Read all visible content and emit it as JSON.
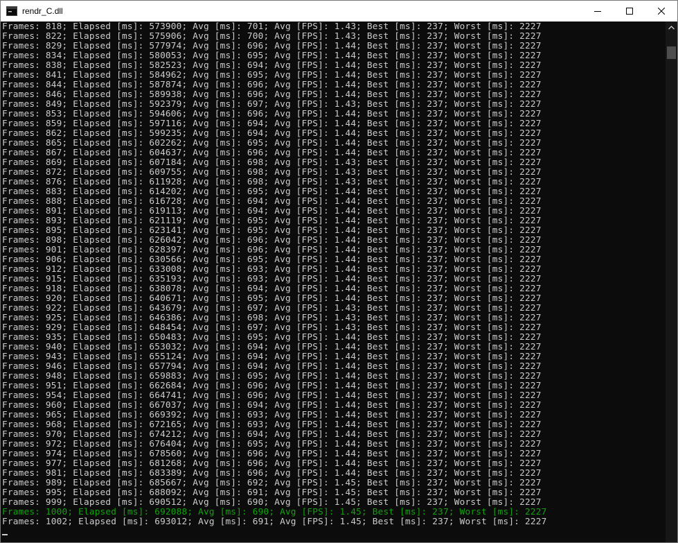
{
  "window": {
    "title": "rendr_C.dll"
  },
  "log": {
    "lines": [
      {
        "text": "Frames: 818; Elapsed [ms]: 573900; Avg [ms]: 701; Avg [FPS]: 1.43; Best [ms]: 237; Worst [ms]: 2227",
        "highlight": false
      },
      {
        "text": "Frames: 822; Elapsed [ms]: 575906; Avg [ms]: 700; Avg [FPS]: 1.43; Best [ms]: 237; Worst [ms]: 2227",
        "highlight": false
      },
      {
        "text": "Frames: 829; Elapsed [ms]: 577974; Avg [ms]: 696; Avg [FPS]: 1.44; Best [ms]: 237; Worst [ms]: 2227",
        "highlight": false
      },
      {
        "text": "Frames: 834; Elapsed [ms]: 580053; Avg [ms]: 695; Avg [FPS]: 1.44; Best [ms]: 237; Worst [ms]: 2227",
        "highlight": false
      },
      {
        "text": "Frames: 838; Elapsed [ms]: 582523; Avg [ms]: 694; Avg [FPS]: 1.44; Best [ms]: 237; Worst [ms]: 2227",
        "highlight": false
      },
      {
        "text": "Frames: 841; Elapsed [ms]: 584962; Avg [ms]: 695; Avg [FPS]: 1.44; Best [ms]: 237; Worst [ms]: 2227",
        "highlight": false
      },
      {
        "text": "Frames: 844; Elapsed [ms]: 587874; Avg [ms]: 696; Avg [FPS]: 1.44; Best [ms]: 237; Worst [ms]: 2227",
        "highlight": false
      },
      {
        "text": "Frames: 846; Elapsed [ms]: 589938; Avg [ms]: 696; Avg [FPS]: 1.44; Best [ms]: 237; Worst [ms]: 2227",
        "highlight": false
      },
      {
        "text": "Frames: 849; Elapsed [ms]: 592379; Avg [ms]: 697; Avg [FPS]: 1.43; Best [ms]: 237; Worst [ms]: 2227",
        "highlight": false
      },
      {
        "text": "Frames: 853; Elapsed [ms]: 594606; Avg [ms]: 696; Avg [FPS]: 1.44; Best [ms]: 237; Worst [ms]: 2227",
        "highlight": false
      },
      {
        "text": "Frames: 859; Elapsed [ms]: 597116; Avg [ms]: 694; Avg [FPS]: 1.44; Best [ms]: 237; Worst [ms]: 2227",
        "highlight": false
      },
      {
        "text": "Frames: 862; Elapsed [ms]: 599235; Avg [ms]: 694; Avg [FPS]: 1.44; Best [ms]: 237; Worst [ms]: 2227",
        "highlight": false
      },
      {
        "text": "Frames: 865; Elapsed [ms]: 602262; Avg [ms]: 695; Avg [FPS]: 1.44; Best [ms]: 237; Worst [ms]: 2227",
        "highlight": false
      },
      {
        "text": "Frames: 867; Elapsed [ms]: 604637; Avg [ms]: 696; Avg [FPS]: 1.44; Best [ms]: 237; Worst [ms]: 2227",
        "highlight": false
      },
      {
        "text": "Frames: 869; Elapsed [ms]: 607184; Avg [ms]: 698; Avg [FPS]: 1.43; Best [ms]: 237; Worst [ms]: 2227",
        "highlight": false
      },
      {
        "text": "Frames: 872; Elapsed [ms]: 609755; Avg [ms]: 698; Avg [FPS]: 1.43; Best [ms]: 237; Worst [ms]: 2227",
        "highlight": false
      },
      {
        "text": "Frames: 876; Elapsed [ms]: 611928; Avg [ms]: 698; Avg [FPS]: 1.43; Best [ms]: 237; Worst [ms]: 2227",
        "highlight": false
      },
      {
        "text": "Frames: 883; Elapsed [ms]: 614202; Avg [ms]: 695; Avg [FPS]: 1.44; Best [ms]: 237; Worst [ms]: 2227",
        "highlight": false
      },
      {
        "text": "Frames: 888; Elapsed [ms]: 616728; Avg [ms]: 694; Avg [FPS]: 1.44; Best [ms]: 237; Worst [ms]: 2227",
        "highlight": false
      },
      {
        "text": "Frames: 891; Elapsed [ms]: 619113; Avg [ms]: 694; Avg [FPS]: 1.44; Best [ms]: 237; Worst [ms]: 2227",
        "highlight": false
      },
      {
        "text": "Frames: 893; Elapsed [ms]: 621119; Avg [ms]: 695; Avg [FPS]: 1.44; Best [ms]: 237; Worst [ms]: 2227",
        "highlight": false
      },
      {
        "text": "Frames: 895; Elapsed [ms]: 623141; Avg [ms]: 695; Avg [FPS]: 1.44; Best [ms]: 237; Worst [ms]: 2227",
        "highlight": false
      },
      {
        "text": "Frames: 898; Elapsed [ms]: 626042; Avg [ms]: 696; Avg [FPS]: 1.44; Best [ms]: 237; Worst [ms]: 2227",
        "highlight": false
      },
      {
        "text": "Frames: 901; Elapsed [ms]: 628397; Avg [ms]: 696; Avg [FPS]: 1.44; Best [ms]: 237; Worst [ms]: 2227",
        "highlight": false
      },
      {
        "text": "Frames: 906; Elapsed [ms]: 630566; Avg [ms]: 695; Avg [FPS]: 1.44; Best [ms]: 237; Worst [ms]: 2227",
        "highlight": false
      },
      {
        "text": "Frames: 912; Elapsed [ms]: 633008; Avg [ms]: 693; Avg [FPS]: 1.44; Best [ms]: 237; Worst [ms]: 2227",
        "highlight": false
      },
      {
        "text": "Frames: 915; Elapsed [ms]: 635193; Avg [ms]: 693; Avg [FPS]: 1.44; Best [ms]: 237; Worst [ms]: 2227",
        "highlight": false
      },
      {
        "text": "Frames: 918; Elapsed [ms]: 638078; Avg [ms]: 694; Avg [FPS]: 1.44; Best [ms]: 237; Worst [ms]: 2227",
        "highlight": false
      },
      {
        "text": "Frames: 920; Elapsed [ms]: 640671; Avg [ms]: 695; Avg [FPS]: 1.44; Best [ms]: 237; Worst [ms]: 2227",
        "highlight": false
      },
      {
        "text": "Frames: 922; Elapsed [ms]: 643679; Avg [ms]: 697; Avg [FPS]: 1.43; Best [ms]: 237; Worst [ms]: 2227",
        "highlight": false
      },
      {
        "text": "Frames: 925; Elapsed [ms]: 646386; Avg [ms]: 698; Avg [FPS]: 1.43; Best [ms]: 237; Worst [ms]: 2227",
        "highlight": false
      },
      {
        "text": "Frames: 929; Elapsed [ms]: 648454; Avg [ms]: 697; Avg [FPS]: 1.43; Best [ms]: 237; Worst [ms]: 2227",
        "highlight": false
      },
      {
        "text": "Frames: 935; Elapsed [ms]: 650483; Avg [ms]: 695; Avg [FPS]: 1.44; Best [ms]: 237; Worst [ms]: 2227",
        "highlight": false
      },
      {
        "text": "Frames: 940; Elapsed [ms]: 653032; Avg [ms]: 694; Avg [FPS]: 1.44; Best [ms]: 237; Worst [ms]: 2227",
        "highlight": false
      },
      {
        "text": "Frames: 943; Elapsed [ms]: 655124; Avg [ms]: 694; Avg [FPS]: 1.44; Best [ms]: 237; Worst [ms]: 2227",
        "highlight": false
      },
      {
        "text": "Frames: 946; Elapsed [ms]: 657794; Avg [ms]: 694; Avg [FPS]: 1.44; Best [ms]: 237; Worst [ms]: 2227",
        "highlight": false
      },
      {
        "text": "Frames: 948; Elapsed [ms]: 659883; Avg [ms]: 695; Avg [FPS]: 1.44; Best [ms]: 237; Worst [ms]: 2227",
        "highlight": false
      },
      {
        "text": "Frames: 951; Elapsed [ms]: 662684; Avg [ms]: 696; Avg [FPS]: 1.44; Best [ms]: 237; Worst [ms]: 2227",
        "highlight": false
      },
      {
        "text": "Frames: 954; Elapsed [ms]: 664741; Avg [ms]: 696; Avg [FPS]: 1.44; Best [ms]: 237; Worst [ms]: 2227",
        "highlight": false
      },
      {
        "text": "Frames: 960; Elapsed [ms]: 667037; Avg [ms]: 694; Avg [FPS]: 1.44; Best [ms]: 237; Worst [ms]: 2227",
        "highlight": false
      },
      {
        "text": "Frames: 965; Elapsed [ms]: 669392; Avg [ms]: 693; Avg [FPS]: 1.44; Best [ms]: 237; Worst [ms]: 2227",
        "highlight": false
      },
      {
        "text": "Frames: 968; Elapsed [ms]: 672165; Avg [ms]: 693; Avg [FPS]: 1.44; Best [ms]: 237; Worst [ms]: 2227",
        "highlight": false
      },
      {
        "text": "Frames: 970; Elapsed [ms]: 674212; Avg [ms]: 694; Avg [FPS]: 1.44; Best [ms]: 237; Worst [ms]: 2227",
        "highlight": false
      },
      {
        "text": "Frames: 972; Elapsed [ms]: 676404; Avg [ms]: 695; Avg [FPS]: 1.44; Best [ms]: 237; Worst [ms]: 2227",
        "highlight": false
      },
      {
        "text": "Frames: 974; Elapsed [ms]: 678560; Avg [ms]: 696; Avg [FPS]: 1.44; Best [ms]: 237; Worst [ms]: 2227",
        "highlight": false
      },
      {
        "text": "Frames: 977; Elapsed [ms]: 681268; Avg [ms]: 696; Avg [FPS]: 1.44; Best [ms]: 237; Worst [ms]: 2227",
        "highlight": false
      },
      {
        "text": "Frames: 981; Elapsed [ms]: 683389; Avg [ms]: 696; Avg [FPS]: 1.44; Best [ms]: 237; Worst [ms]: 2227",
        "highlight": false
      },
      {
        "text": "Frames: 989; Elapsed [ms]: 685667; Avg [ms]: 692; Avg [FPS]: 1.45; Best [ms]: 237; Worst [ms]: 2227",
        "highlight": false
      },
      {
        "text": "Frames: 995; Elapsed [ms]: 688092; Avg [ms]: 691; Avg [FPS]: 1.45; Best [ms]: 237; Worst [ms]: 2227",
        "highlight": false
      },
      {
        "text": "Frames: 999; Elapsed [ms]: 690512; Avg [ms]: 690; Avg [FPS]: 1.45; Best [ms]: 237; Worst [ms]: 2227",
        "highlight": false
      },
      {
        "text": "Frames: 1000; Elapsed [ms]: 692088; Avg [ms]: 690; Avg [FPS]: 1.45; Best [ms]: 237; Worst [ms]: 2227",
        "highlight": true
      },
      {
        "text": "Frames: 1002; Elapsed [ms]: 693012; Avg [ms]: 691; Avg [FPS]: 1.45; Best [ms]: 237; Worst [ms]: 2227",
        "highlight": false
      }
    ]
  },
  "colors": {
    "text": "#cccccc",
    "highlight": "#13a10e",
    "background": "#0c0c0c"
  },
  "icons": {
    "app": "console-app-icon",
    "minimize": "minimize-icon",
    "maximize": "maximize-icon",
    "close": "close-icon",
    "scroll_up": "scroll-up-arrow-icon"
  }
}
